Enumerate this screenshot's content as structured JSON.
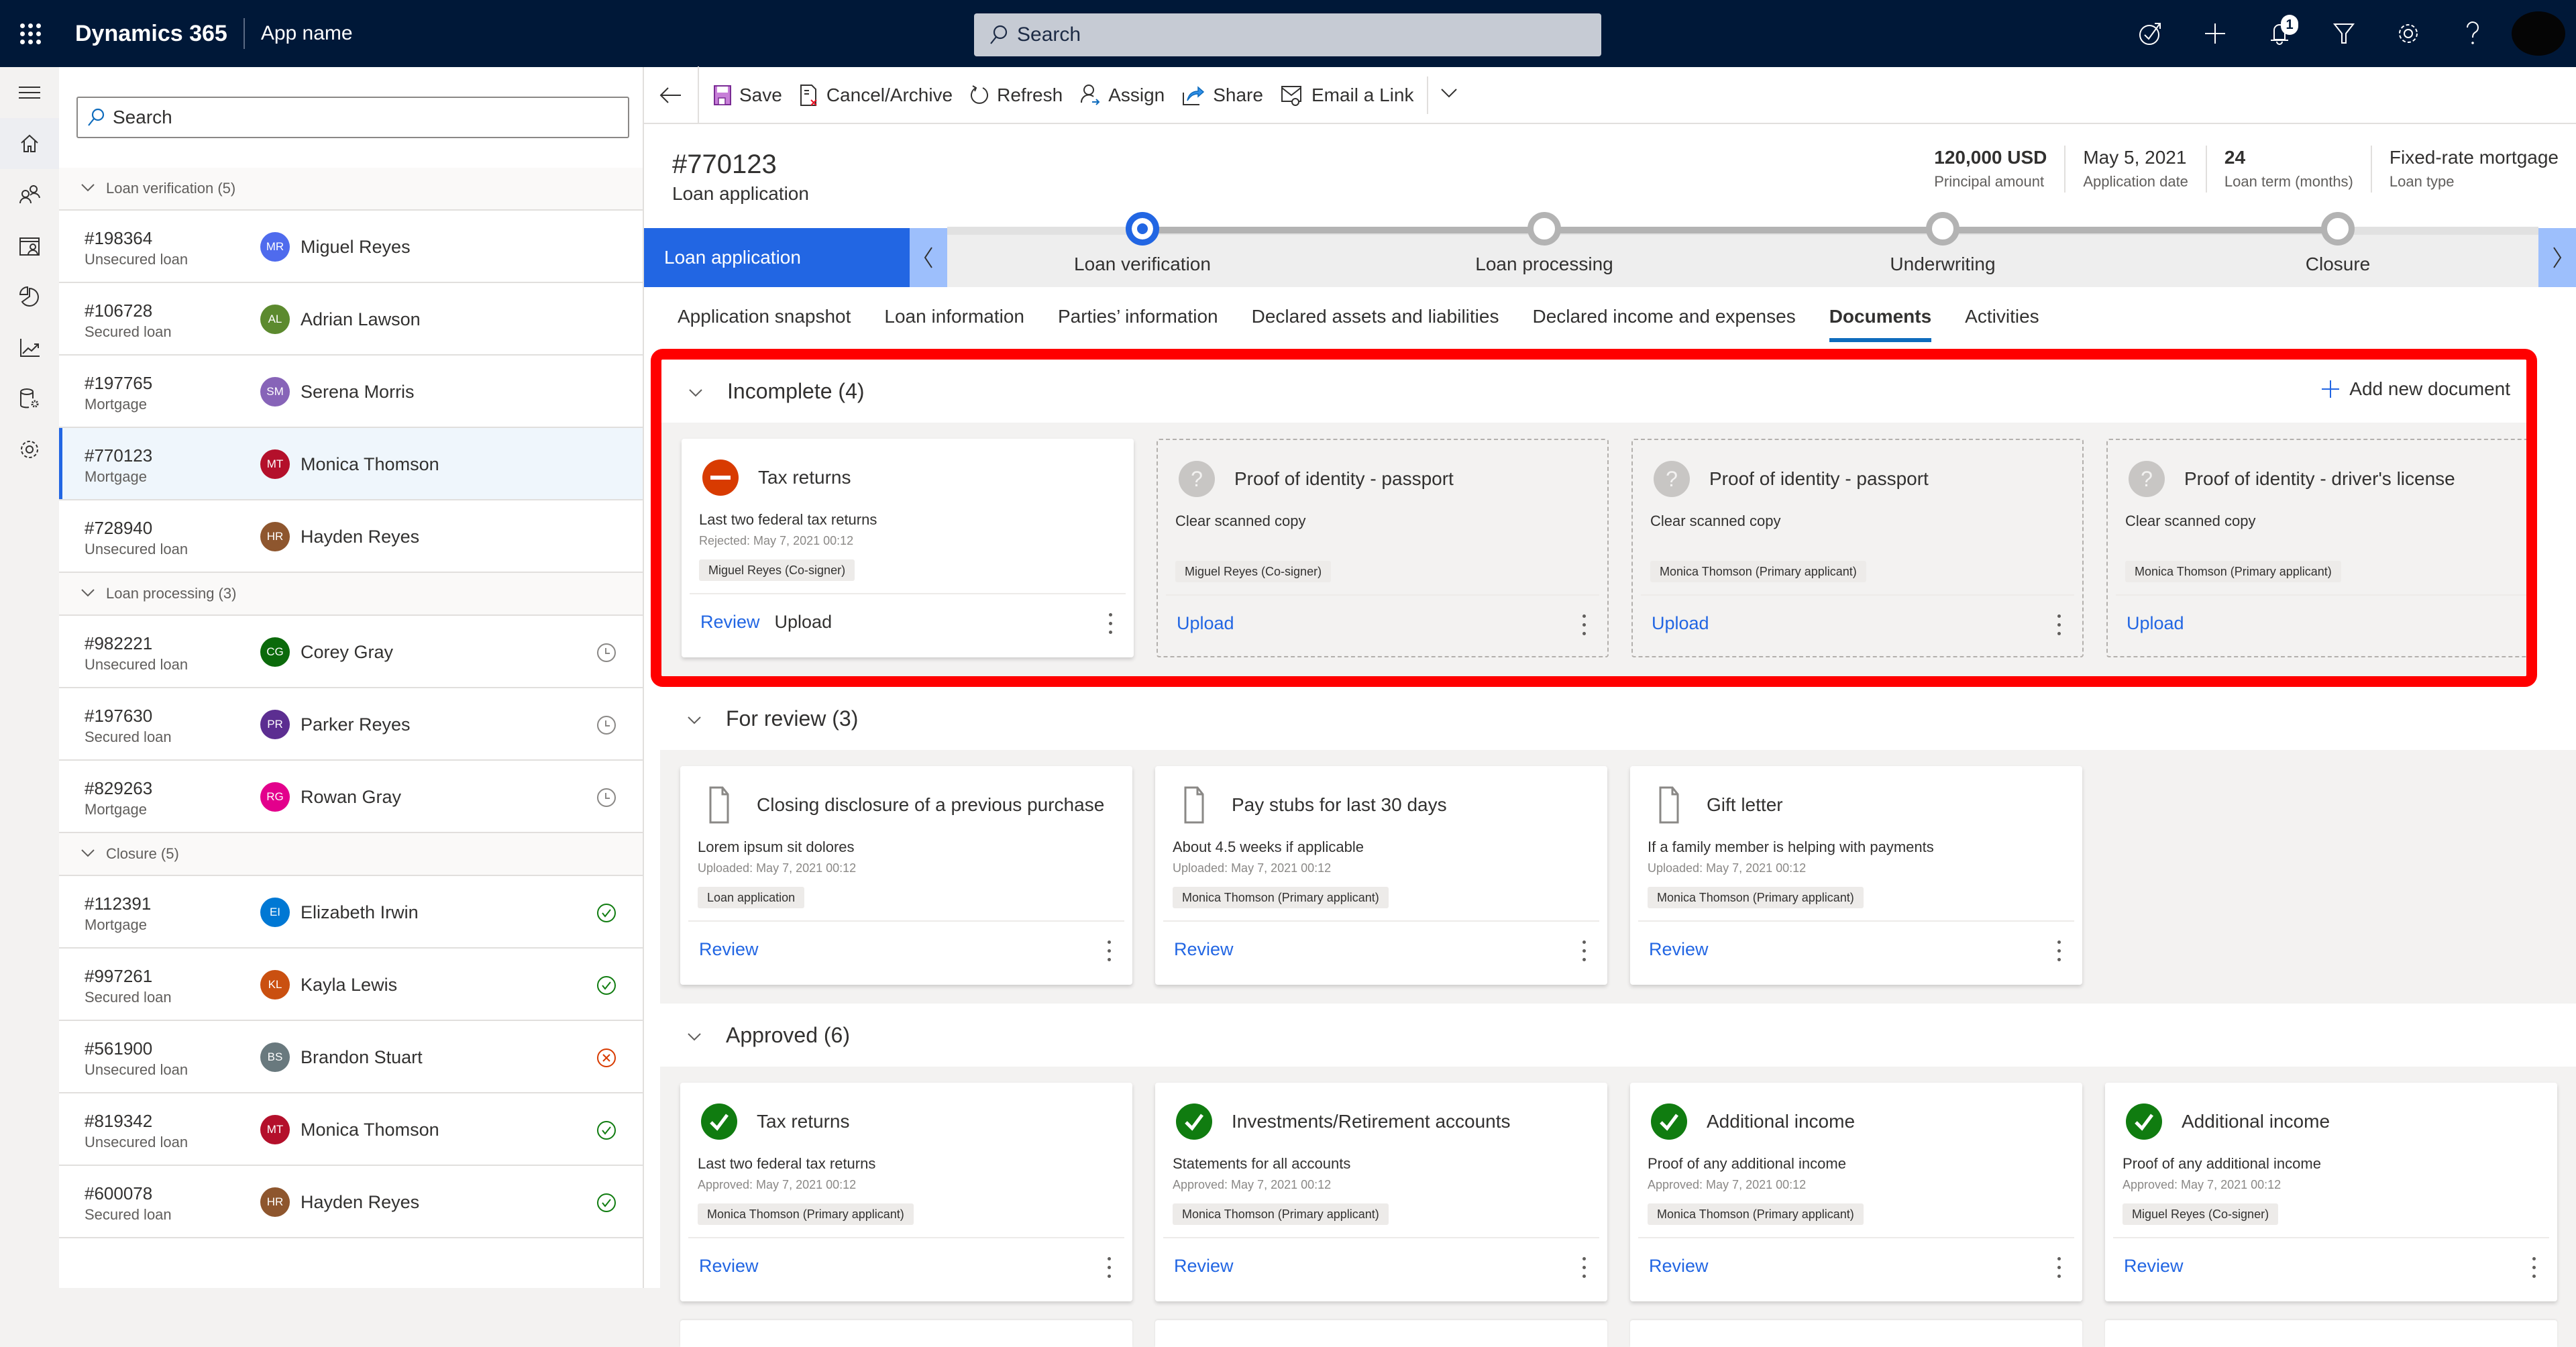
{
  "topbar": {
    "brand": "Dynamics 365",
    "app_name": "App name",
    "search_placeholder": "Search",
    "notification_count": "1",
    "icons": [
      "task-icon",
      "plus-icon",
      "bell-icon",
      "filter-icon",
      "gear-icon",
      "help-icon",
      "user-avatar"
    ]
  },
  "rail": {
    "items": [
      "hamburger-icon",
      "home-icon",
      "contacts-icon",
      "calendar-person-icon",
      "pie-chart-icon",
      "trend-chart-icon",
      "database-settings-icon",
      "gear-icon"
    ]
  },
  "list": {
    "search_placeholder": "Search",
    "groups": [
      {
        "label": "Loan verification (5)",
        "rows": [
          {
            "id": "#198364",
            "type": "Unsecured loan",
            "initials": "MR",
            "name": "Miguel Reyes",
            "color": "#4f6bed",
            "status": "",
            "selected": false
          },
          {
            "id": "#106728",
            "type": "Secured loan",
            "initials": "AL",
            "name": "Adrian Lawson",
            "color": "#5c8a2e",
            "status": "",
            "selected": false
          },
          {
            "id": "#197765",
            "type": "Mortgage",
            "initials": "SM",
            "name": "Serena Morris",
            "color": "#8764b8",
            "status": "",
            "selected": false
          },
          {
            "id": "#770123",
            "type": "Mortgage",
            "initials": "MT",
            "name": "Monica Thomson",
            "color": "#b4102b",
            "status": "",
            "selected": true
          },
          {
            "id": "#728940",
            "type": "Unsecured loan",
            "initials": "HR",
            "name": "Hayden Reyes",
            "color": "#8e562e",
            "status": "",
            "selected": false
          }
        ]
      },
      {
        "label": "Loan processing (3)",
        "rows": [
          {
            "id": "#982221",
            "type": "Unsecured loan",
            "initials": "CG",
            "name": "Corey Gray",
            "color": "#0b6a0b",
            "status": "pending"
          },
          {
            "id": "#197630",
            "type": "Secured loan",
            "initials": "PR",
            "name": "Parker Reyes",
            "color": "#5c2e91",
            "status": "pending"
          },
          {
            "id": "#829263",
            "type": "Mortgage",
            "initials": "RG",
            "name": "Rowan Gray",
            "color": "#e3008c",
            "status": "pending"
          }
        ]
      },
      {
        "label": "Closure (5)",
        "rows": [
          {
            "id": "#112391",
            "type": "Mortgage",
            "initials": "EI",
            "name": "Elizabeth Irwin",
            "color": "#0078d4",
            "status": "approved"
          },
          {
            "id": "#997261",
            "type": "Secured loan",
            "initials": "KL",
            "name": "Kayla Lewis",
            "color": "#ca5010",
            "status": "approved"
          },
          {
            "id": "#561900",
            "type": "Unsecured loan",
            "initials": "BS",
            "name": "Brandon Stuart",
            "color": "#69797e",
            "status": "rejected"
          },
          {
            "id": "#819342",
            "type": "Unsecured loan",
            "initials": "MT",
            "name": "Monica Thomson",
            "color": "#b4102b",
            "status": "approved"
          },
          {
            "id": "#600078",
            "type": "Secured loan",
            "initials": "HR",
            "name": "Hayden Reyes",
            "color": "#8e562e",
            "status": "approved"
          }
        ]
      }
    ]
  },
  "commandbar": {
    "buttons": [
      {
        "label": "Save",
        "icon": "save-icon"
      },
      {
        "label": "Cancel/Archive",
        "icon": "cancel-archive-icon"
      },
      {
        "label": "Refresh",
        "icon": "refresh-icon"
      },
      {
        "label": "Assign",
        "icon": "assign-icon"
      },
      {
        "label": "Share",
        "icon": "share-icon"
      },
      {
        "label": "Email a Link",
        "icon": "email-link-icon"
      }
    ]
  },
  "record": {
    "title": "#770123",
    "subtitle": "Loan application",
    "fields": [
      {
        "value": "120,000 USD",
        "label": "Principal amount",
        "bold": true
      },
      {
        "value": "May 5, 2021",
        "label": "Application date",
        "bold": false
      },
      {
        "value": "24",
        "label": "Loan term (months)",
        "bold": true
      },
      {
        "value": "Fixed-rate mortgage",
        "label": "Loan type",
        "bold": false
      }
    ]
  },
  "bpf": {
    "current_stage": "Loan application",
    "steps": [
      "Loan verification",
      "Loan processing",
      "Underwriting",
      "Closure"
    ],
    "active_step": 0
  },
  "tabs": [
    "Application snapshot",
    "Loan information",
    "Parties’ information",
    "Declared assets and liabilities",
    "Declared income and expenses",
    "Documents",
    "Activities"
  ],
  "active_tab": "Documents",
  "sections": [
    {
      "title": "Incomplete (4)",
      "add_label": "Add new document",
      "cards": [
        {
          "icon": "rejected",
          "title": "Tax returns",
          "desc": "Last two federal tax returns",
          "meta": "Rejected: May 7, 2021   00:12",
          "tag": "Miguel Reyes  (Co-signer)",
          "actions": [
            "Review",
            "Upload"
          ],
          "placeholder": false
        },
        {
          "icon": "unknown",
          "title": "Proof of identity - passport",
          "desc": "Clear scanned copy",
          "meta": "",
          "tag": "Miguel Reyes  (Co-signer)",
          "actions": [
            "Upload"
          ],
          "placeholder": true
        },
        {
          "icon": "unknown",
          "title": "Proof of identity - passport",
          "desc": "Clear scanned copy",
          "meta": "",
          "tag": "Monica Thomson (Primary applicant)",
          "actions": [
            "Upload"
          ],
          "placeholder": true
        },
        {
          "icon": "unknown",
          "title": "Proof of identity - driver's license",
          "desc": "Clear scanned copy",
          "meta": "",
          "tag": "Monica Thomson (Primary applicant)",
          "actions": [
            "Upload"
          ],
          "placeholder": true
        }
      ]
    },
    {
      "title": "For review  (3)",
      "cards": [
        {
          "icon": "document",
          "title": "Closing disclosure of a previous purchase",
          "desc": "Lorem ipsum sit dolores",
          "meta": "Uploaded: May 7, 2021   00:12",
          "tag": "Loan application",
          "actions": [
            "Review"
          ],
          "placeholder": false
        },
        {
          "icon": "document",
          "title": "Pay stubs for last 30 days",
          "desc": "About 4.5 weeks if applicable",
          "meta": "Uploaded: May 7, 2021   00:12",
          "tag": "Monica Thomson (Primary applicant)",
          "actions": [
            "Review"
          ],
          "placeholder": false
        },
        {
          "icon": "document",
          "title": "Gift letter",
          "desc": "If a family member is helping with payments",
          "meta": "Uploaded: May 7, 2021   00:12",
          "tag": "Monica Thomson (Primary applicant)",
          "actions": [
            "Review"
          ],
          "placeholder": false
        }
      ]
    },
    {
      "title": "Approved (6)",
      "cards": [
        {
          "icon": "approved",
          "title": "Tax returns",
          "desc": "Last two federal tax returns",
          "meta": "Approved: May 7, 2021   00:12",
          "tag": "Monica Thomson (Primary applicant)",
          "actions": [
            "Review"
          ],
          "placeholder": false
        },
        {
          "icon": "approved",
          "title": "Investments/Retirement accounts",
          "desc": "Statements for all accounts",
          "meta": "Approved: May 7, 2021   00:12",
          "tag": "Monica Thomson (Primary applicant)",
          "actions": [
            "Review"
          ],
          "placeholder": false
        },
        {
          "icon": "approved",
          "title": "Additional income",
          "desc": "Proof of any additional income",
          "meta": "Approved: May 7, 2021   00:12",
          "tag": "Monica Thomson (Primary applicant)",
          "actions": [
            "Review"
          ],
          "placeholder": false
        },
        {
          "icon": "approved",
          "title": "Additional income",
          "desc": "Proof of any additional income",
          "meta": "Approved: May 7, 2021   00:12",
          "tag": "Miguel Reyes  (Co-signer)",
          "actions": [
            "Review"
          ],
          "placeholder": false
        }
      ]
    }
  ],
  "colors": {
    "topbar": "#001838",
    "accent": "#2266e3",
    "highlight_border": "#ff0000",
    "approved": "#107c10",
    "rejected": "#d83b01"
  }
}
